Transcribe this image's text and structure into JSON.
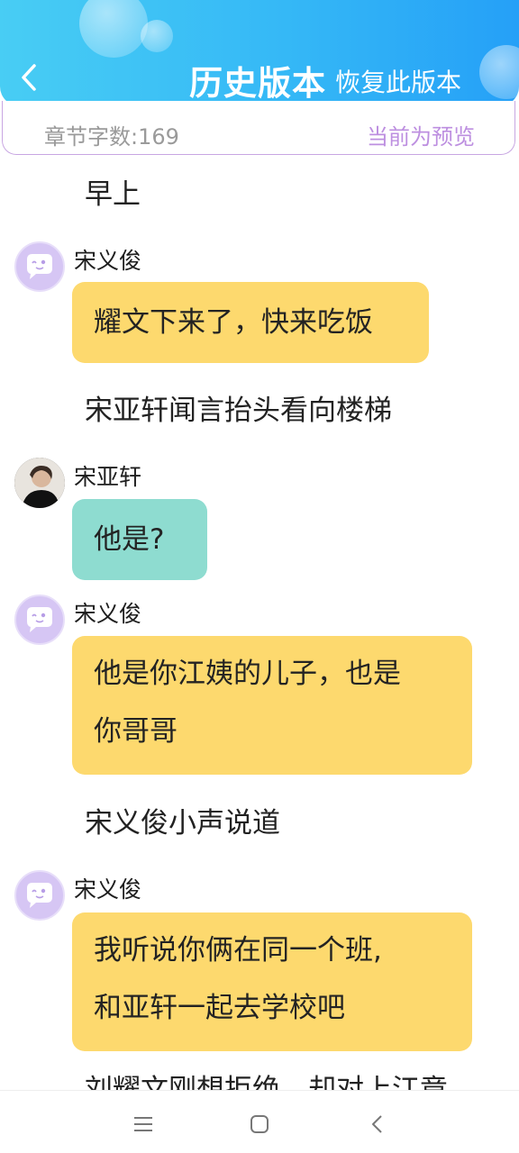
{
  "header": {
    "title": "历史版本",
    "restore_label": "恢复此版本",
    "back_icon": "chevron-left-icon"
  },
  "info": {
    "word_count": "章节字数:169",
    "status": "当前为预览"
  },
  "colors": {
    "header_start": "#48cdf4",
    "header_end": "#25a0f7",
    "accent_purple": "#bd8fe0",
    "bubble_yellow": "#fdd96e",
    "bubble_teal": "#8edcd0"
  },
  "content": {
    "narration_1": "早上",
    "speaker_1": "宋义俊",
    "msg_1": "耀文下来了，快来吃饭",
    "narration_2": "宋亚轩闻言抬头看向楼梯",
    "speaker_2": "宋亚轩",
    "msg_2": "他是?",
    "speaker_3": "宋义俊",
    "msg_3_line1": "他是你江姨的儿子，也是",
    "msg_3_line2": "你哥哥",
    "narration_3": "宋义俊小声说道",
    "speaker_4": "宋义俊",
    "msg_4_line1": "我听说你俩在同一个班,",
    "msg_4_line2": "和亚轩一起去学校吧",
    "narration_4_cut": "刘耀文刚想拒绝，却对上江竟"
  },
  "navbar": {
    "menu_icon": "menu-icon",
    "home_icon": "home-square-icon",
    "back_icon": "back-triangle-icon"
  }
}
